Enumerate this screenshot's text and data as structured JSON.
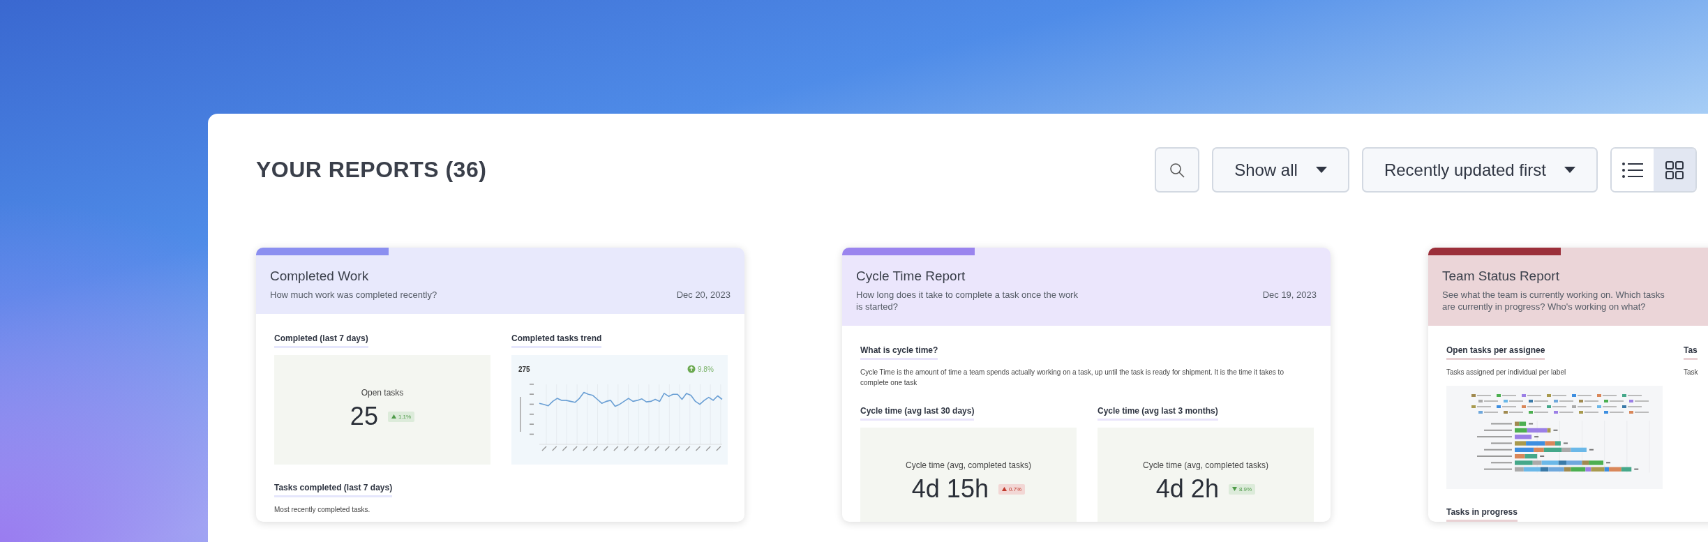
{
  "header": {
    "title": "YOUR REPORTS (36)",
    "filter": {
      "label": "Show all"
    },
    "sort": {
      "label": "Recently updated first"
    },
    "view_toggle": [
      {
        "kind": "list",
        "selected": false
      },
      {
        "kind": "grid",
        "selected": true
      }
    ]
  },
  "cards": [
    {
      "title": "Completed Work",
      "description": "How much work was completed recently?",
      "date": "Dec 20, 2023",
      "color": "#8b8ff0",
      "rows": [
        {
          "widgets": [
            {
              "kind": "stat",
              "heading": "Completed (last 7 days)",
              "label": "Open tasks",
              "value": "25",
              "change": {
                "text": "1.1%",
                "increase": true,
                "color": "#4e9a48"
              }
            },
            {
              "kind": "line_chart",
              "heading": "Completed tasks trend",
              "total": "275",
              "change": "9.8%"
            }
          ]
        },
        {
          "widgets": [
            {
              "kind": "text",
              "heading": "Tasks completed (last 7 days)",
              "text": "Most recently completed tasks."
            }
          ]
        }
      ]
    },
    {
      "title": "Cycle Time Report",
      "description": "How long does it take to complete a task once the work is started?",
      "date": "Dec 19, 2023",
      "color": "#9a84ee",
      "rows": [
        {
          "widgets": [
            {
              "kind": "text",
              "heading": "What is cycle time?",
              "text": "Cycle Time is the amount of time a team spends actually working on a task, up until the task is ready for shipment. It is the time it takes to complete one task"
            }
          ]
        },
        {
          "widgets": [
            {
              "kind": "stat",
              "heading": "Cycle time (avg last 30 days)",
              "label": "Cycle time (avg, completed tasks)",
              "value": "4d 15h",
              "change": {
                "text": "0.7%",
                "increase": true,
                "color": "#c0392b"
              }
            },
            {
              "kind": "stat",
              "heading": "Cycle time (avg last 3 months)",
              "label": "Cycle time (avg, completed tasks)",
              "value": "4d 2h",
              "change": {
                "text": "8.9%",
                "increase": false,
                "color": "#4e9a48"
              }
            }
          ]
        }
      ]
    },
    {
      "title": "Team Status Report",
      "description": "See what the team is currently working on. Which tasks are currently in progress? Who's working on what?",
      "color": "#9b2f3a",
      "rows": [
        {
          "widgets": [
            {
              "kind": "bar_chart",
              "heading": "Open tasks per assignee",
              "text": "Tasks assigned per individual per label"
            },
            {
              "kind": "text",
              "heading": "Tas",
              "text": "Task"
            }
          ]
        },
        {
          "widgets": [
            {
              "kind": "text",
              "heading": "Tasks in progress"
            }
          ]
        }
      ]
    }
  ]
}
